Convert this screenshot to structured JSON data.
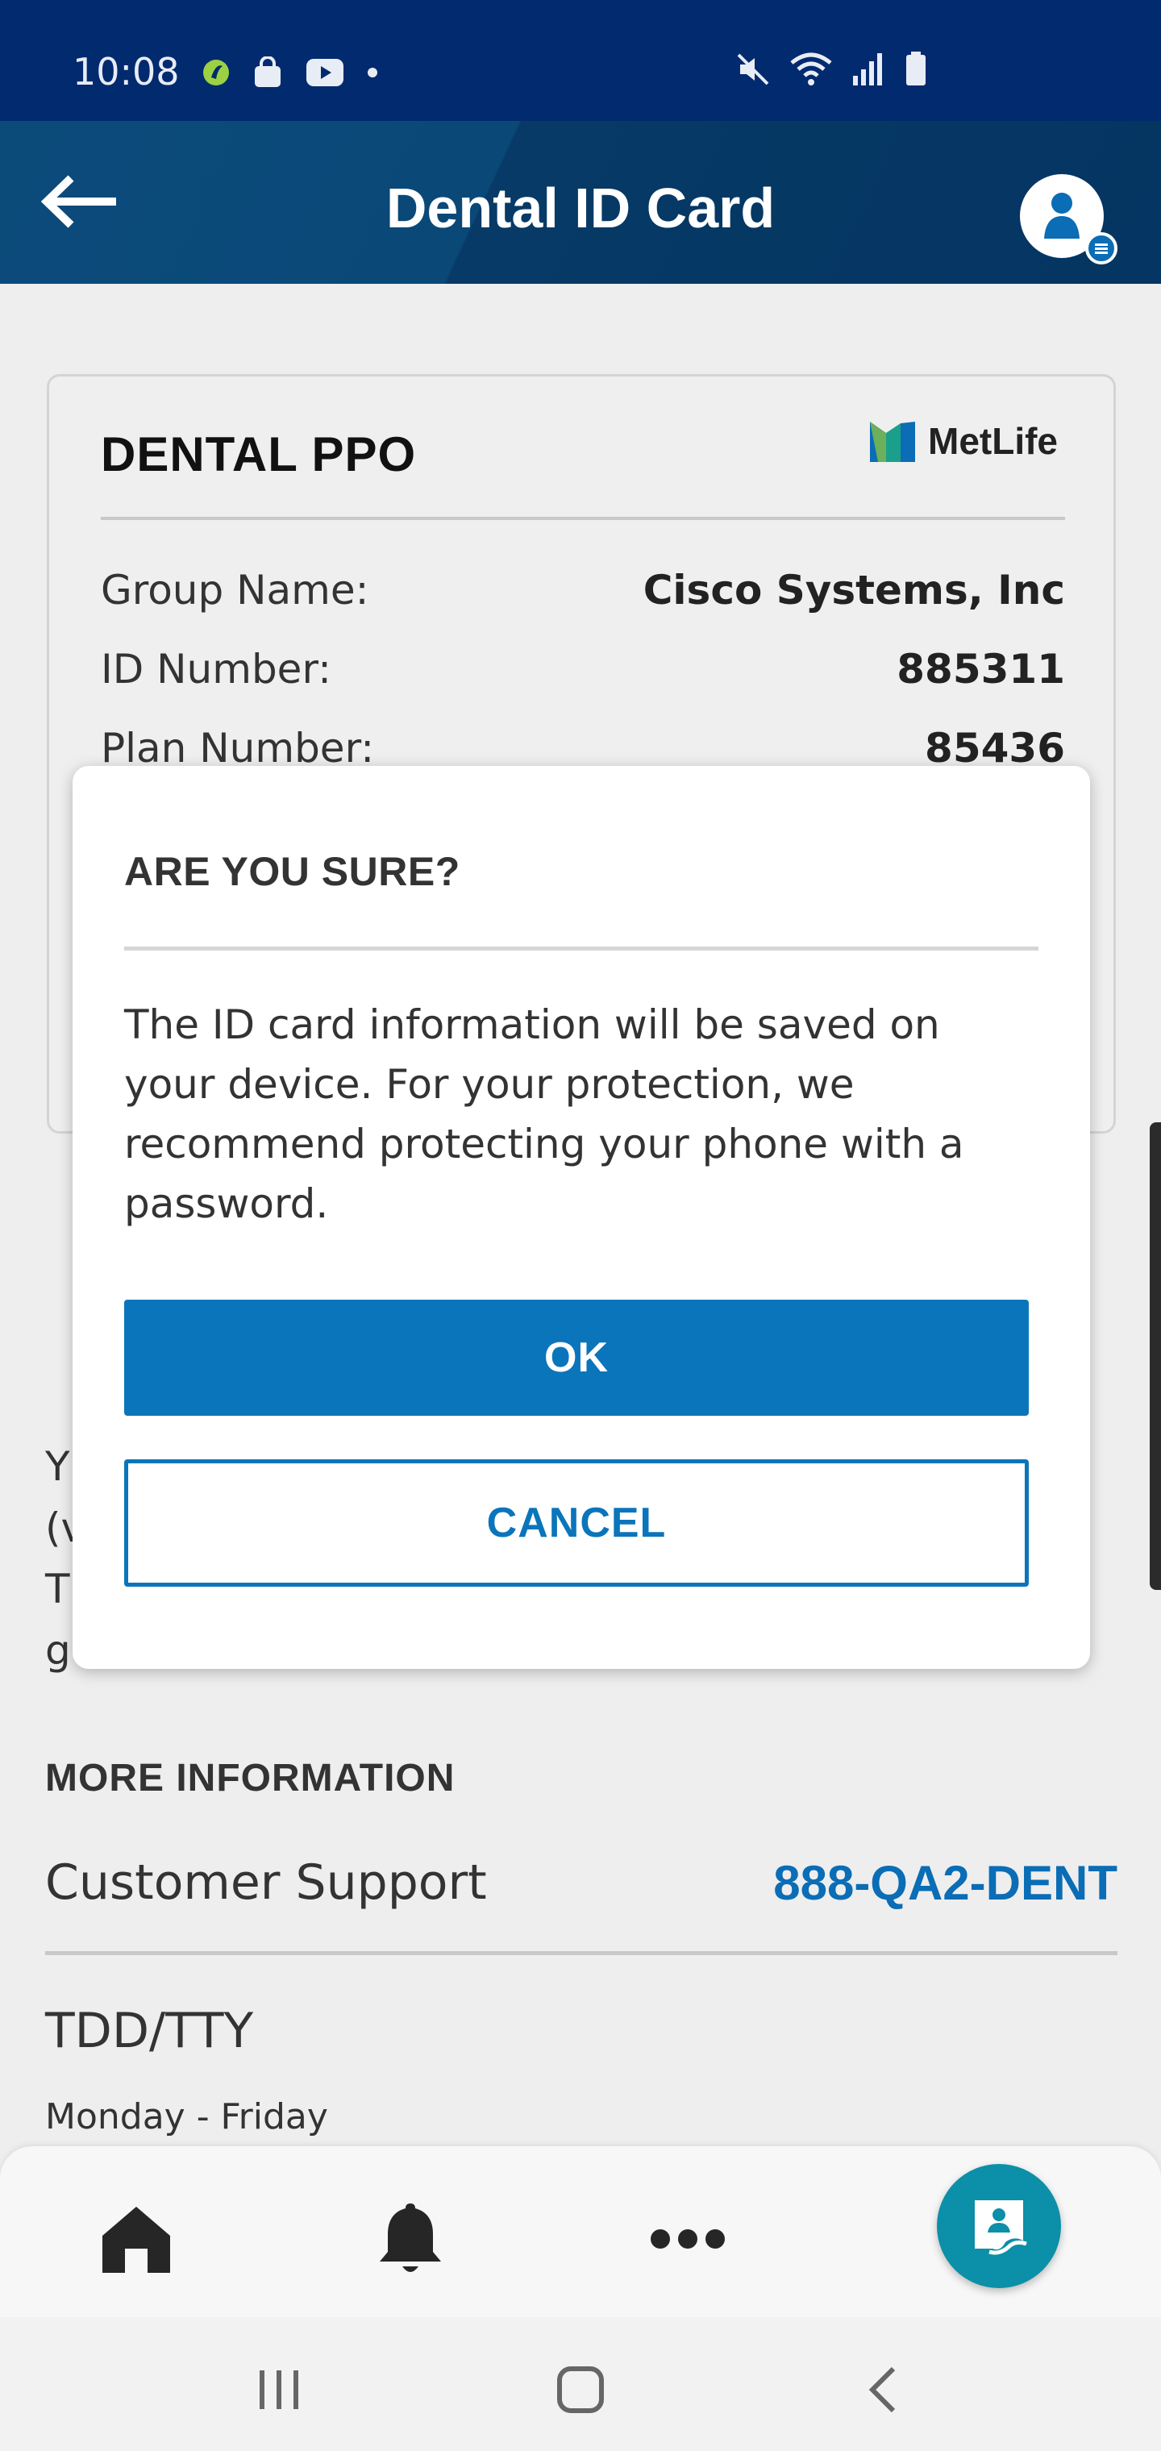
{
  "status_bar": {
    "time": "10:08",
    "left_icons": [
      "app-notification-icon",
      "bag-icon",
      "youtube-icon",
      "dot-icon"
    ],
    "right_icons": [
      "mute-icon",
      "wifi-icon",
      "signal-icon",
      "battery-icon"
    ]
  },
  "app_bar": {
    "title": "Dental ID Card",
    "back_icon": "back-arrow-icon",
    "profile_icon": "profile-icon"
  },
  "id_card": {
    "plan_title": "DENTAL PPO",
    "brand": "MetLife",
    "rows": [
      {
        "label": "Group Name:",
        "value": "Cisco Systems, Inc"
      },
      {
        "label": "ID Number:",
        "value": "885311"
      },
      {
        "label": "Plan Number:",
        "value": "85436"
      }
    ]
  },
  "background_text": {
    "line1": "Y",
    "line2": "(v",
    "line3": "T",
    "line4": "g"
  },
  "more_info": {
    "heading": "MORE INFORMATION",
    "customer_support_label": "Customer Support",
    "customer_support_phone": "888-QA2-DENT",
    "tdd_label": "TDD/TTY",
    "hours": "Monday - Friday"
  },
  "dialog": {
    "title": "ARE YOU SURE?",
    "message": "The ID card information will be saved on your device. For your protection, we recommend protecting your phone with a password.",
    "ok_label": "OK",
    "cancel_label": "CANCEL"
  },
  "bottom_nav": {
    "items": [
      "home-icon",
      "bell-icon",
      "more-icon",
      "id-card-icon"
    ]
  },
  "colors": {
    "status_bar": "#022a6e",
    "app_bar": "#0a4878",
    "accent_blue": "#0b75bb",
    "fab_teal": "#0c8fa8"
  }
}
